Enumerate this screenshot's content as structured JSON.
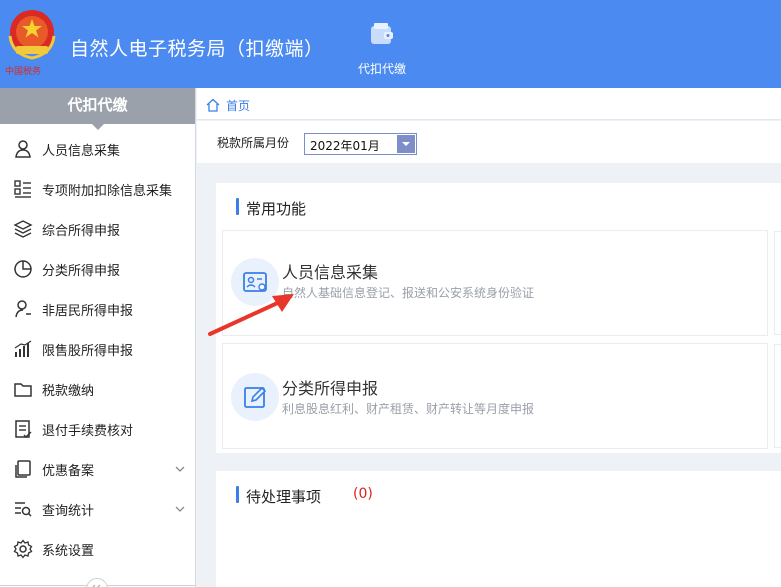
{
  "header": {
    "title": "自然人电子税务局（扣缴端）",
    "logo_text": "中国税务",
    "nav_item": {
      "label": "代扣代缴",
      "icon": "wallet-icon"
    }
  },
  "sidebar": {
    "heading": "代扣代缴",
    "items": [
      {
        "label": "人员信息采集",
        "icon": "person-icon"
      },
      {
        "label": "专项附加扣除信息采集",
        "icon": "list-grid-icon"
      },
      {
        "label": "综合所得申报",
        "icon": "layers-icon"
      },
      {
        "label": "分类所得申报",
        "icon": "pie-chart-icon"
      },
      {
        "label": "非居民所得申报",
        "icon": "user-outline-icon"
      },
      {
        "label": "限售股所得申报",
        "icon": "bar-chart-icon"
      },
      {
        "label": "税款缴纳",
        "icon": "folder-icon"
      },
      {
        "label": "退付手续费核对",
        "icon": "document-check-icon"
      },
      {
        "label": "优惠备案",
        "icon": "copy-icon",
        "expandable": true
      },
      {
        "label": "查询统计",
        "icon": "search-list-icon",
        "expandable": true
      },
      {
        "label": "系统设置",
        "icon": "gear-icon"
      }
    ]
  },
  "breadcrumb": {
    "home": "首页"
  },
  "filter": {
    "label": "税款所属月份",
    "month_value": "2022年01月"
  },
  "common_functions": {
    "title": "常用功能",
    "cards": [
      {
        "title": "人员信息采集",
        "desc": "自然人基础信息登记、报送和公安系统身份验证",
        "icon": "id-card-icon"
      },
      {
        "title": "分类所得申报",
        "desc": "利息股息红利、财产租赁、财产转让等月度申报",
        "icon": "edit-icon"
      }
    ]
  },
  "pending": {
    "title": "待处理事项",
    "count": "(0)"
  },
  "colors": {
    "header_blue": "#4a8af1",
    "accent_blue": "#3a7ee8",
    "pending_red": "#e02020",
    "annotation_red": "#e8372a"
  }
}
